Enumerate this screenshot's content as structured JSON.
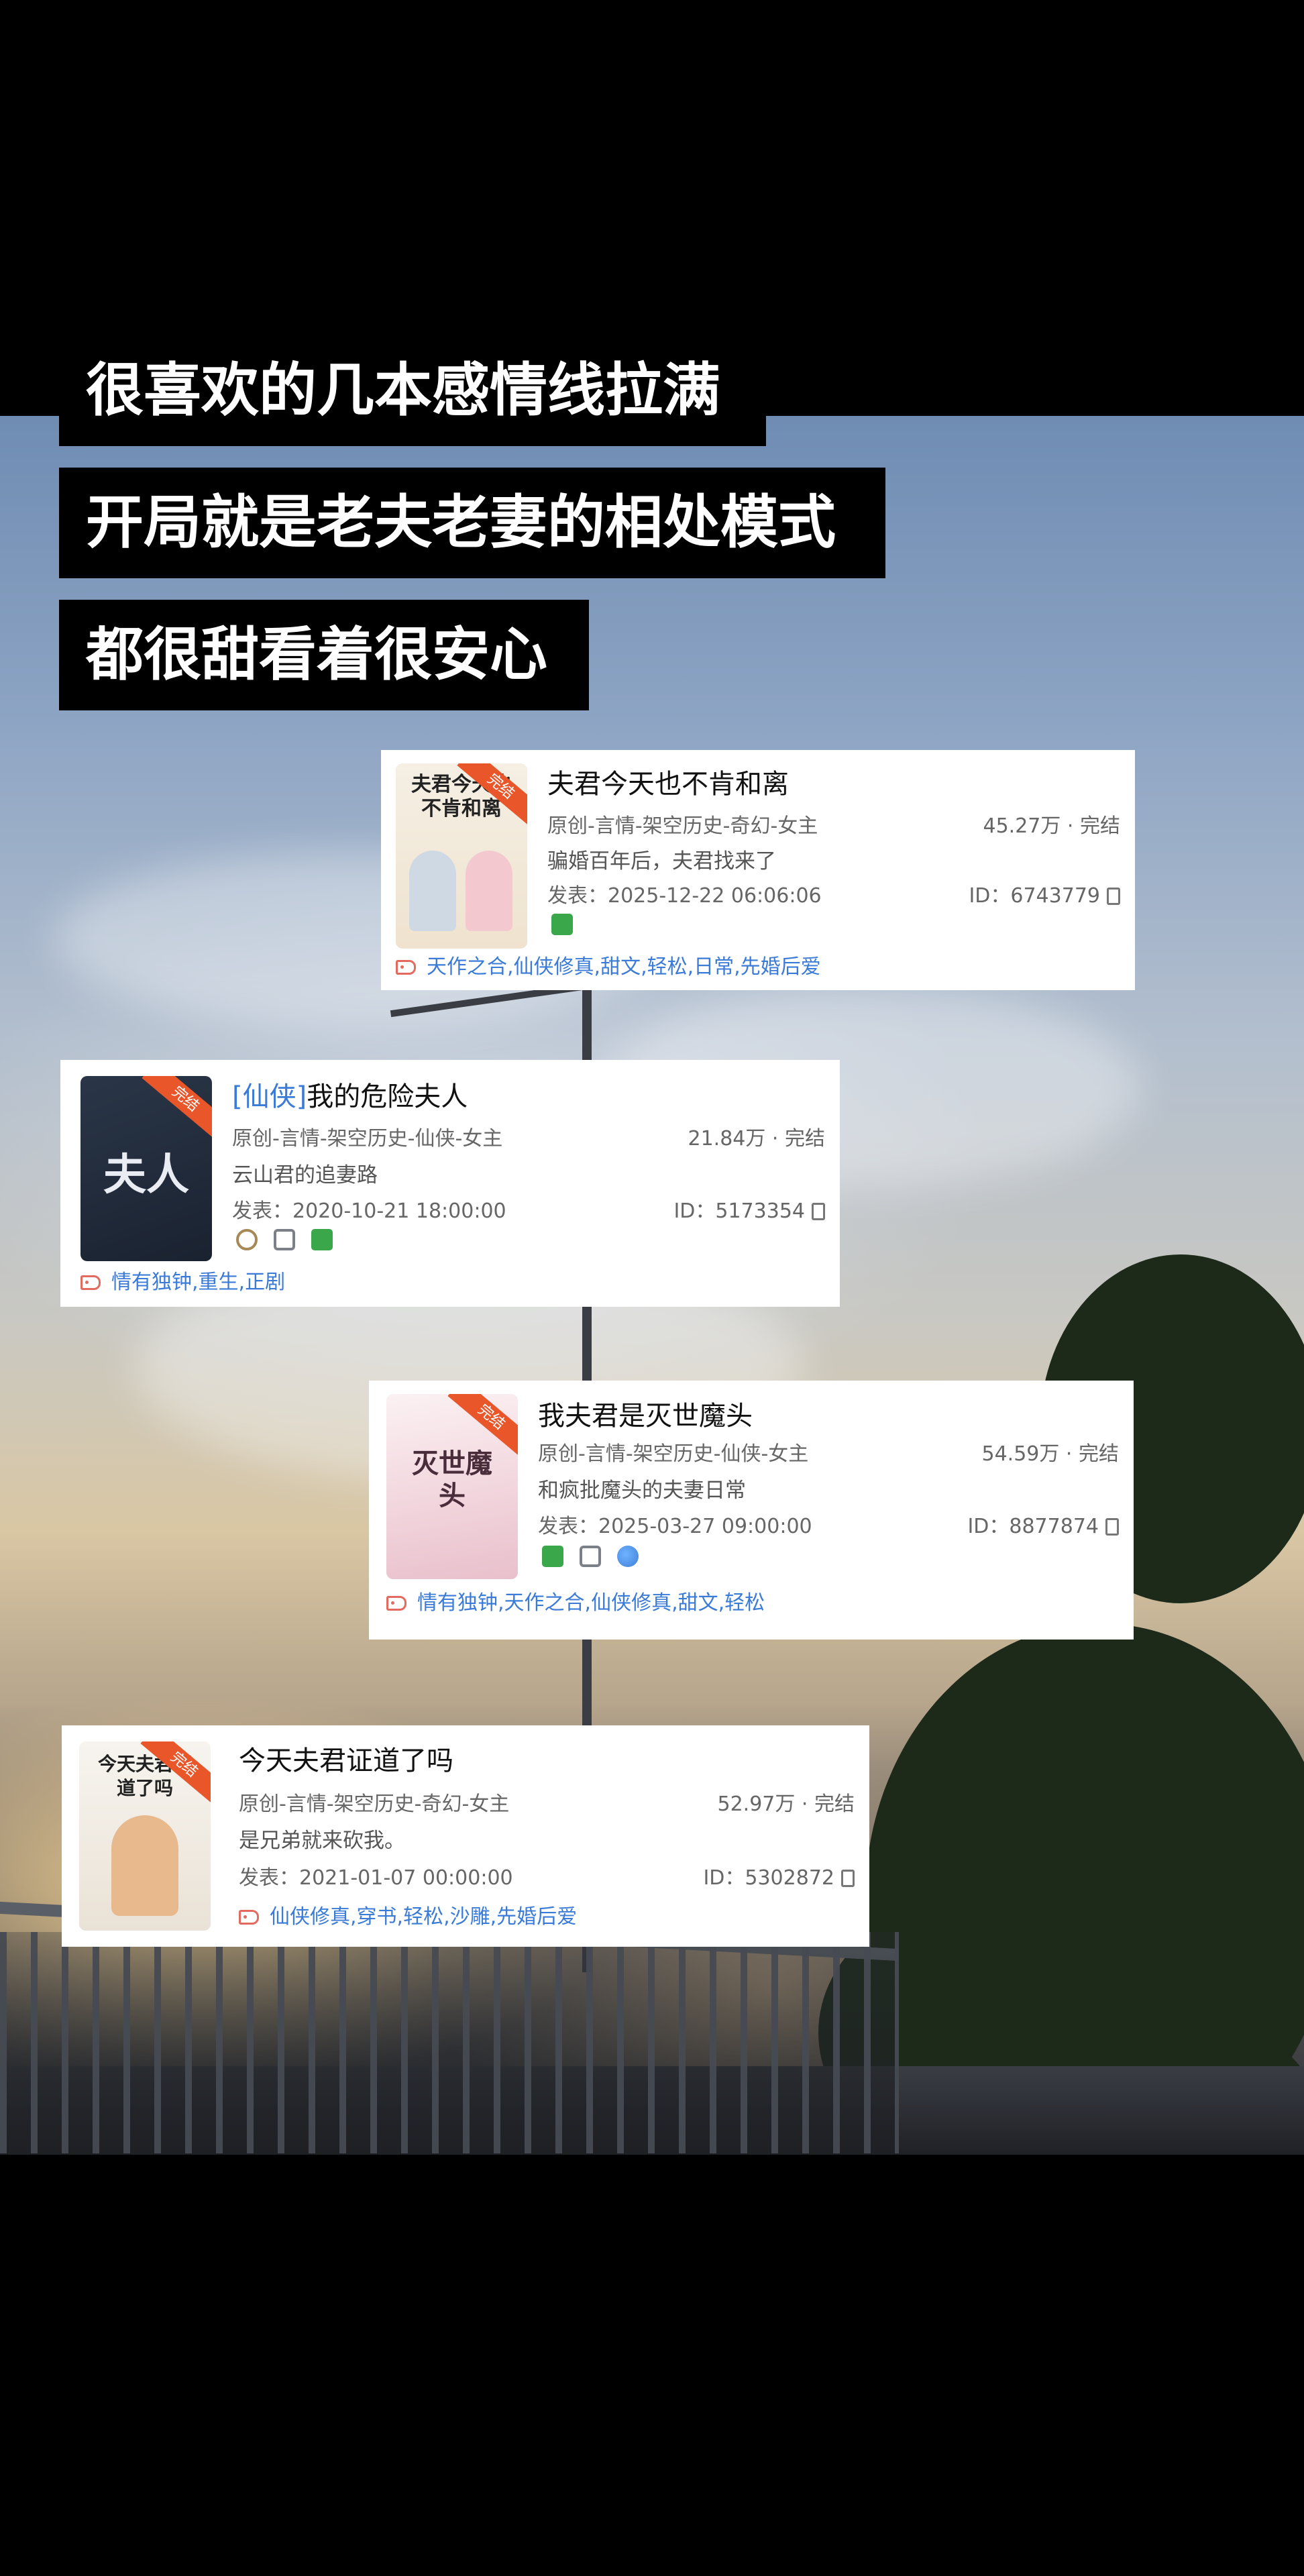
{
  "captions": [
    "很喜欢的几本感情线拉满",
    "开局就是老夫老妻的相处模式",
    "都很甜看着很安心"
  ],
  "books": [
    {
      "title": "夫君今天也不肯和离",
      "title_prefix": "",
      "category": "原创-言情-架空历史-奇幻-女主",
      "stats": "45.27万 · 完结",
      "blurb": "骗婚百年后，夫君找来了",
      "published": "发表：2025-12-22 06:06:06",
      "id": "ID：6743779",
      "tags": "天作之合,仙侠修真,甜文,轻松,日常,先婚后爱",
      "cover_text": "夫君今天也不肯和离",
      "ribbon": "完结",
      "badges": [
        "book-icon"
      ]
    },
    {
      "title": "我的危险夫人",
      "title_prefix": "[仙侠]",
      "category": "原创-言情-架空历史-仙侠-女主",
      "stats": "21.84万 · 完结",
      "blurb": "云山君的追妻路",
      "published": "发表：2020-10-21 18:00:00",
      "id": "ID：5173354",
      "tags": "情有独钟,重生,正剧",
      "cover_text": "夫人",
      "ribbon": "完结",
      "badges": [
        "audio-icon",
        "tv-icon",
        "book-icon"
      ]
    },
    {
      "title": "我夫君是灭世魔头",
      "title_prefix": "",
      "category": "原创-言情-架空历史-仙侠-女主",
      "stats": "54.59万 · 完结",
      "blurb": "和疯批魔头的夫妻日常",
      "published": "发表：2025-03-27 09:00:00",
      "id": "ID：8877874",
      "tags": "情有独钟,天作之合,仙侠修真,甜文,轻松",
      "cover_text": "灭世魔头",
      "ribbon": "完结",
      "badges": [
        "book-icon",
        "tv-icon",
        "web-icon"
      ]
    },
    {
      "title": "今天夫君证道了吗",
      "title_prefix": "",
      "category": "原创-言情-架空历史-奇幻-女主",
      "stats": "52.97万 · 完结",
      "blurb": "是兄弟就来砍我。",
      "published": "发表：2021-01-07 00:00:00",
      "id": "ID：5302872",
      "tags": "仙侠修真,穿书,轻松,沙雕,先婚后爱",
      "cover_text": "今天夫君证道了吗",
      "ribbon": "完结",
      "badges": []
    }
  ],
  "colors": {
    "tag_link": "#3b7bd8",
    "caption_bg": "#000000",
    "ribbon": "#e8562a"
  }
}
